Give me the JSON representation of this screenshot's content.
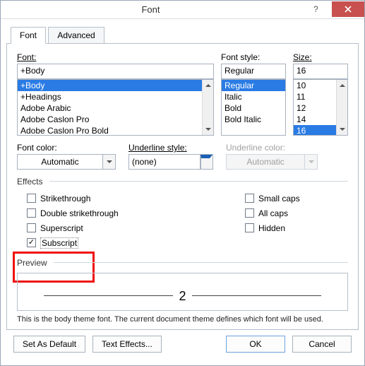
{
  "title": "Font",
  "tabs": {
    "font": "Font",
    "advanced": "Advanced"
  },
  "labels": {
    "font": "Font:",
    "fontStyle": "Font style:",
    "size": "Size:",
    "fontColor": "Font color:",
    "underlineStyle": "Underline style:",
    "underlineColor": "Underline color:",
    "effects": "Effects",
    "preview": "Preview"
  },
  "font": {
    "value": "+Body",
    "items": [
      "+Body",
      "+Headings",
      "Adobe Arabic",
      "Adobe Caslon Pro",
      "Adobe Caslon Pro Bold"
    ],
    "selectedIndex": 0
  },
  "fontStyle": {
    "value": "Regular",
    "items": [
      "Regular",
      "Italic",
      "Bold",
      "Bold Italic"
    ],
    "selectedIndex": 0
  },
  "size": {
    "value": "16",
    "items": [
      "10",
      "11",
      "12",
      "14",
      "16"
    ],
    "selectedIndex": 4
  },
  "fontColor": "Automatic",
  "underlineStyle": "(none)",
  "underlineColor": "Automatic",
  "effects": {
    "strikethrough": "Strikethrough",
    "doubleStrikethrough": "Double strikethrough",
    "superscript": "Superscript",
    "subscript": "Subscript",
    "smallCaps": "Small caps",
    "allCaps": "All caps",
    "hidden": "Hidden"
  },
  "effectsState": {
    "strikethrough": false,
    "doubleStrikethrough": false,
    "superscript": false,
    "subscript": true,
    "smallCaps": false,
    "allCaps": false,
    "hidden": false
  },
  "previewText": "2",
  "footnote": "This is the body theme font. The current document theme defines which font will be used.",
  "buttons": {
    "setDefault": "Set As Default",
    "textEffects": "Text Effects...",
    "ok": "OK",
    "cancel": "Cancel"
  }
}
